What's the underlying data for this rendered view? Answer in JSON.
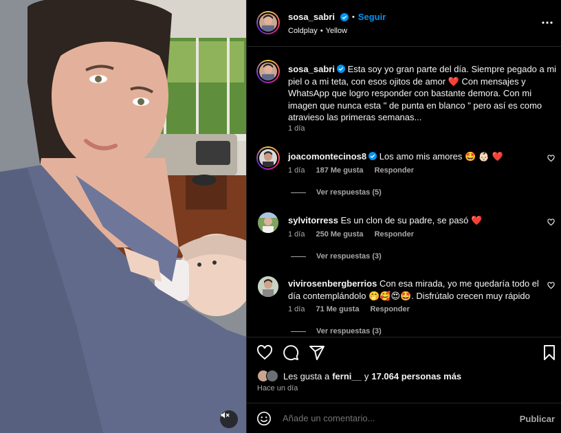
{
  "colors": {
    "background": "#000000",
    "text": "#f5f5f5",
    "muted": "#a8a8a8",
    "accent": "#0095f6",
    "heart": "#ff3040",
    "border": "#262626"
  },
  "media": {
    "mute_icon": "speaker-muted-icon"
  },
  "header": {
    "username": "sosa_sabri",
    "separator": "•",
    "follow_label": "Seguir",
    "audio_artist": "Coldplay",
    "audio_separator": "•",
    "audio_song": "Yellow",
    "more_icon": "more-icon"
  },
  "caption": {
    "username": "sosa_sabri",
    "line1": "Esta soy yo gran parte del día. Siempre pegado a mi",
    "line2": "piel o a mi teta, con esos ojitos de amor ❤️  Con mensajes y",
    "line3": "WhatsApp que logro responder con bastante demora. Con mi",
    "line4": "imagen que nunca esta \" de punta en blanco \" pero así es como",
    "line5": "atravieso las primeras semanas...",
    "time": "1 día"
  },
  "comments": [
    {
      "username": "joacomontecinos8",
      "text": "Los amo mis amores 🤩 👶🏻 ❤️",
      "time": "1 día",
      "likes": "187 Me gusta",
      "reply": "Responder",
      "view_replies": "Ver respuestas (5)"
    },
    {
      "username": "sylvitorress",
      "text": "Es un clon de su padre, se pasó ❤️",
      "time": "1 día",
      "likes": "250 Me gusta",
      "reply": "Responder",
      "view_replies": "Ver respuestas (3)"
    },
    {
      "username": "vivirosenbergberrios",
      "text": "Con esa mirada, yo me quedaría todo el",
      "text2": "día contemplándolo 🤭🥰😍🤩. Disfrútalo crecen muy rápido",
      "time": "1 día",
      "likes": "71 Me gusta",
      "reply": "Responder",
      "view_replies": "Ver respuestas (3)"
    }
  ],
  "likes": {
    "prefix": "Les gusta a",
    "user": "ferni__",
    "middle": "y",
    "count": "17.064 personas más"
  },
  "posted": "Hace un día",
  "comment_box": {
    "placeholder": "Añade un comentario...",
    "publish": "Publicar"
  }
}
